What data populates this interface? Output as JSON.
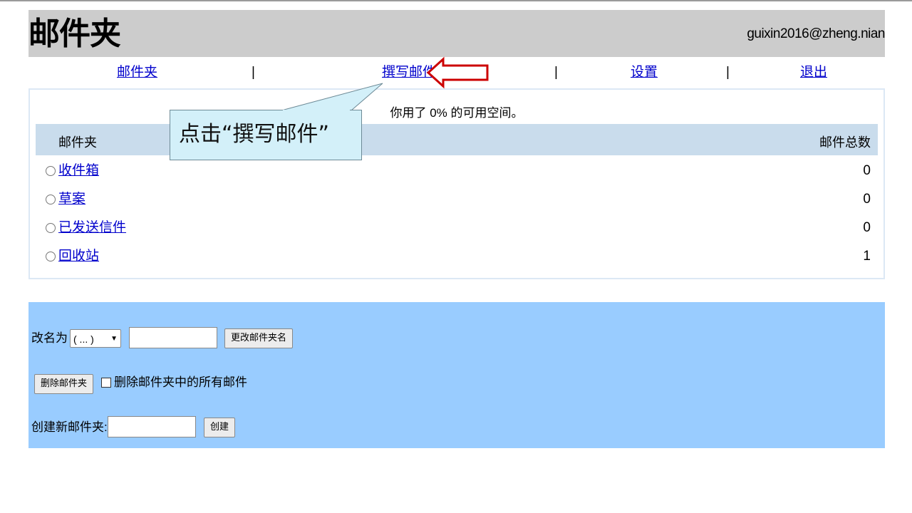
{
  "header": {
    "title": "邮件夹",
    "user_email": "guixin2016@zheng.nian"
  },
  "nav": {
    "items": [
      {
        "label": "邮件夹"
      },
      {
        "label": "撰写邮件"
      },
      {
        "label": "设置"
      },
      {
        "label": "退出"
      }
    ],
    "separator": "|"
  },
  "quota_text": "你用了 0% 的可用空间。",
  "table": {
    "columns": [
      "邮件夹",
      "邮件总数"
    ],
    "rows": [
      {
        "name": "收件箱",
        "count": "0"
      },
      {
        "name": "草案",
        "count": "0"
      },
      {
        "name": "已发送信件",
        "count": "0"
      },
      {
        "name": "回收站",
        "count": "1"
      }
    ]
  },
  "tools": {
    "rename_label": "改名为",
    "rename_select_value": "( ... )",
    "rename_input_value": "",
    "rename_button": "更改邮件夹名",
    "delete_button": "删除邮件夹",
    "delete_all_label": "删除邮件夹中的所有邮件",
    "create_label": "创建新邮件夹:",
    "create_input_value": "",
    "create_button": "创建"
  },
  "annotation": {
    "callout_text": "点击“撰写邮件”",
    "arrow_color": "#cc0000",
    "callout_fill": "#d3f0f9"
  }
}
